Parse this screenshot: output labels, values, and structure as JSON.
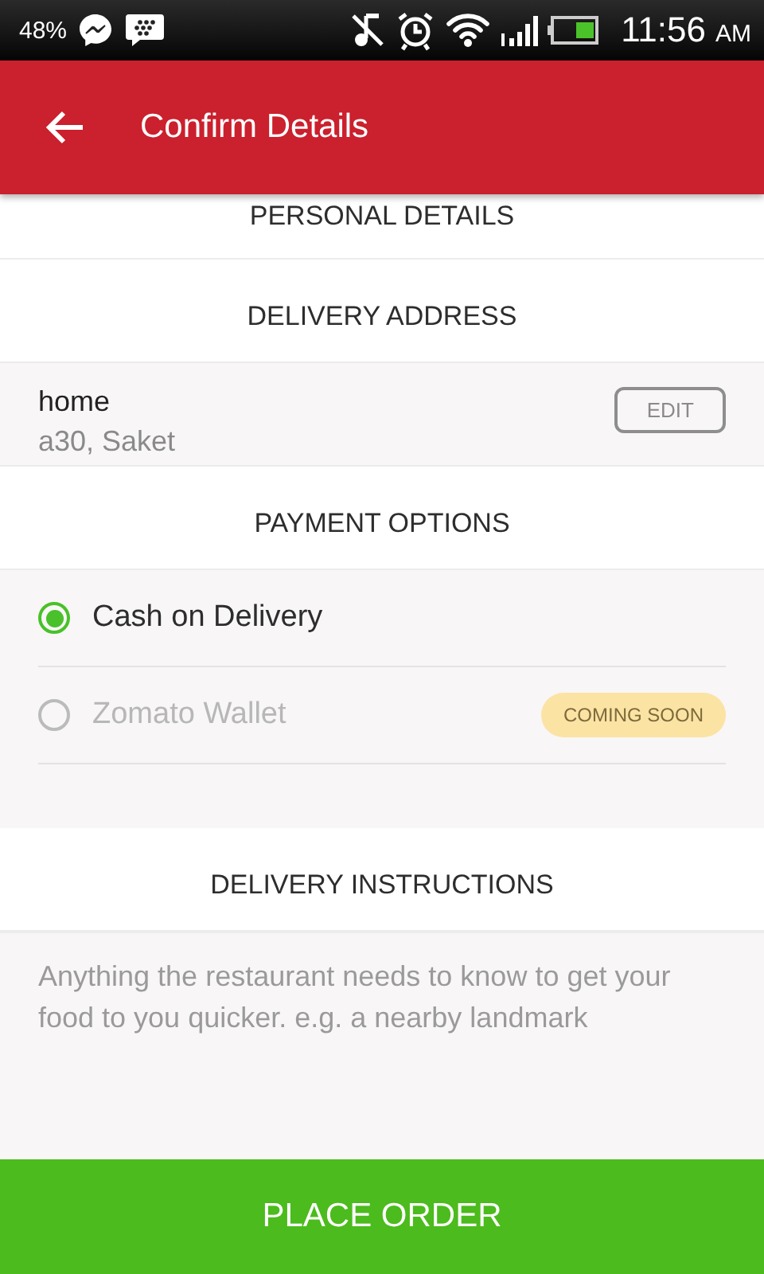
{
  "status_bar": {
    "battery_percent": "48%",
    "time": "11:56",
    "meridiem": "AM"
  },
  "app_bar": {
    "title": "Confirm Details"
  },
  "sections": [
    {
      "heading": "PERSONAL DETAILS"
    },
    {
      "heading": "DELIVERY ADDRESS",
      "address": {
        "name": "home",
        "line": "a30, Saket",
        "action": "EDIT"
      }
    },
    {
      "heading": "PAYMENT OPTIONS",
      "options": [
        {
          "label": "Cash on Delivery",
          "selected": true,
          "disabled": false
        },
        {
          "label": "Zomato Wallet",
          "selected": false,
          "disabled": true,
          "badge": "COMING SOON"
        }
      ]
    },
    {
      "heading": "DELIVERY INSTRUCTIONS",
      "placeholder": "Anything the restaurant needs to know to get your food to you quicker. e.g. a nearby landmark"
    }
  ],
  "primary_button": "PLACE ORDER"
}
